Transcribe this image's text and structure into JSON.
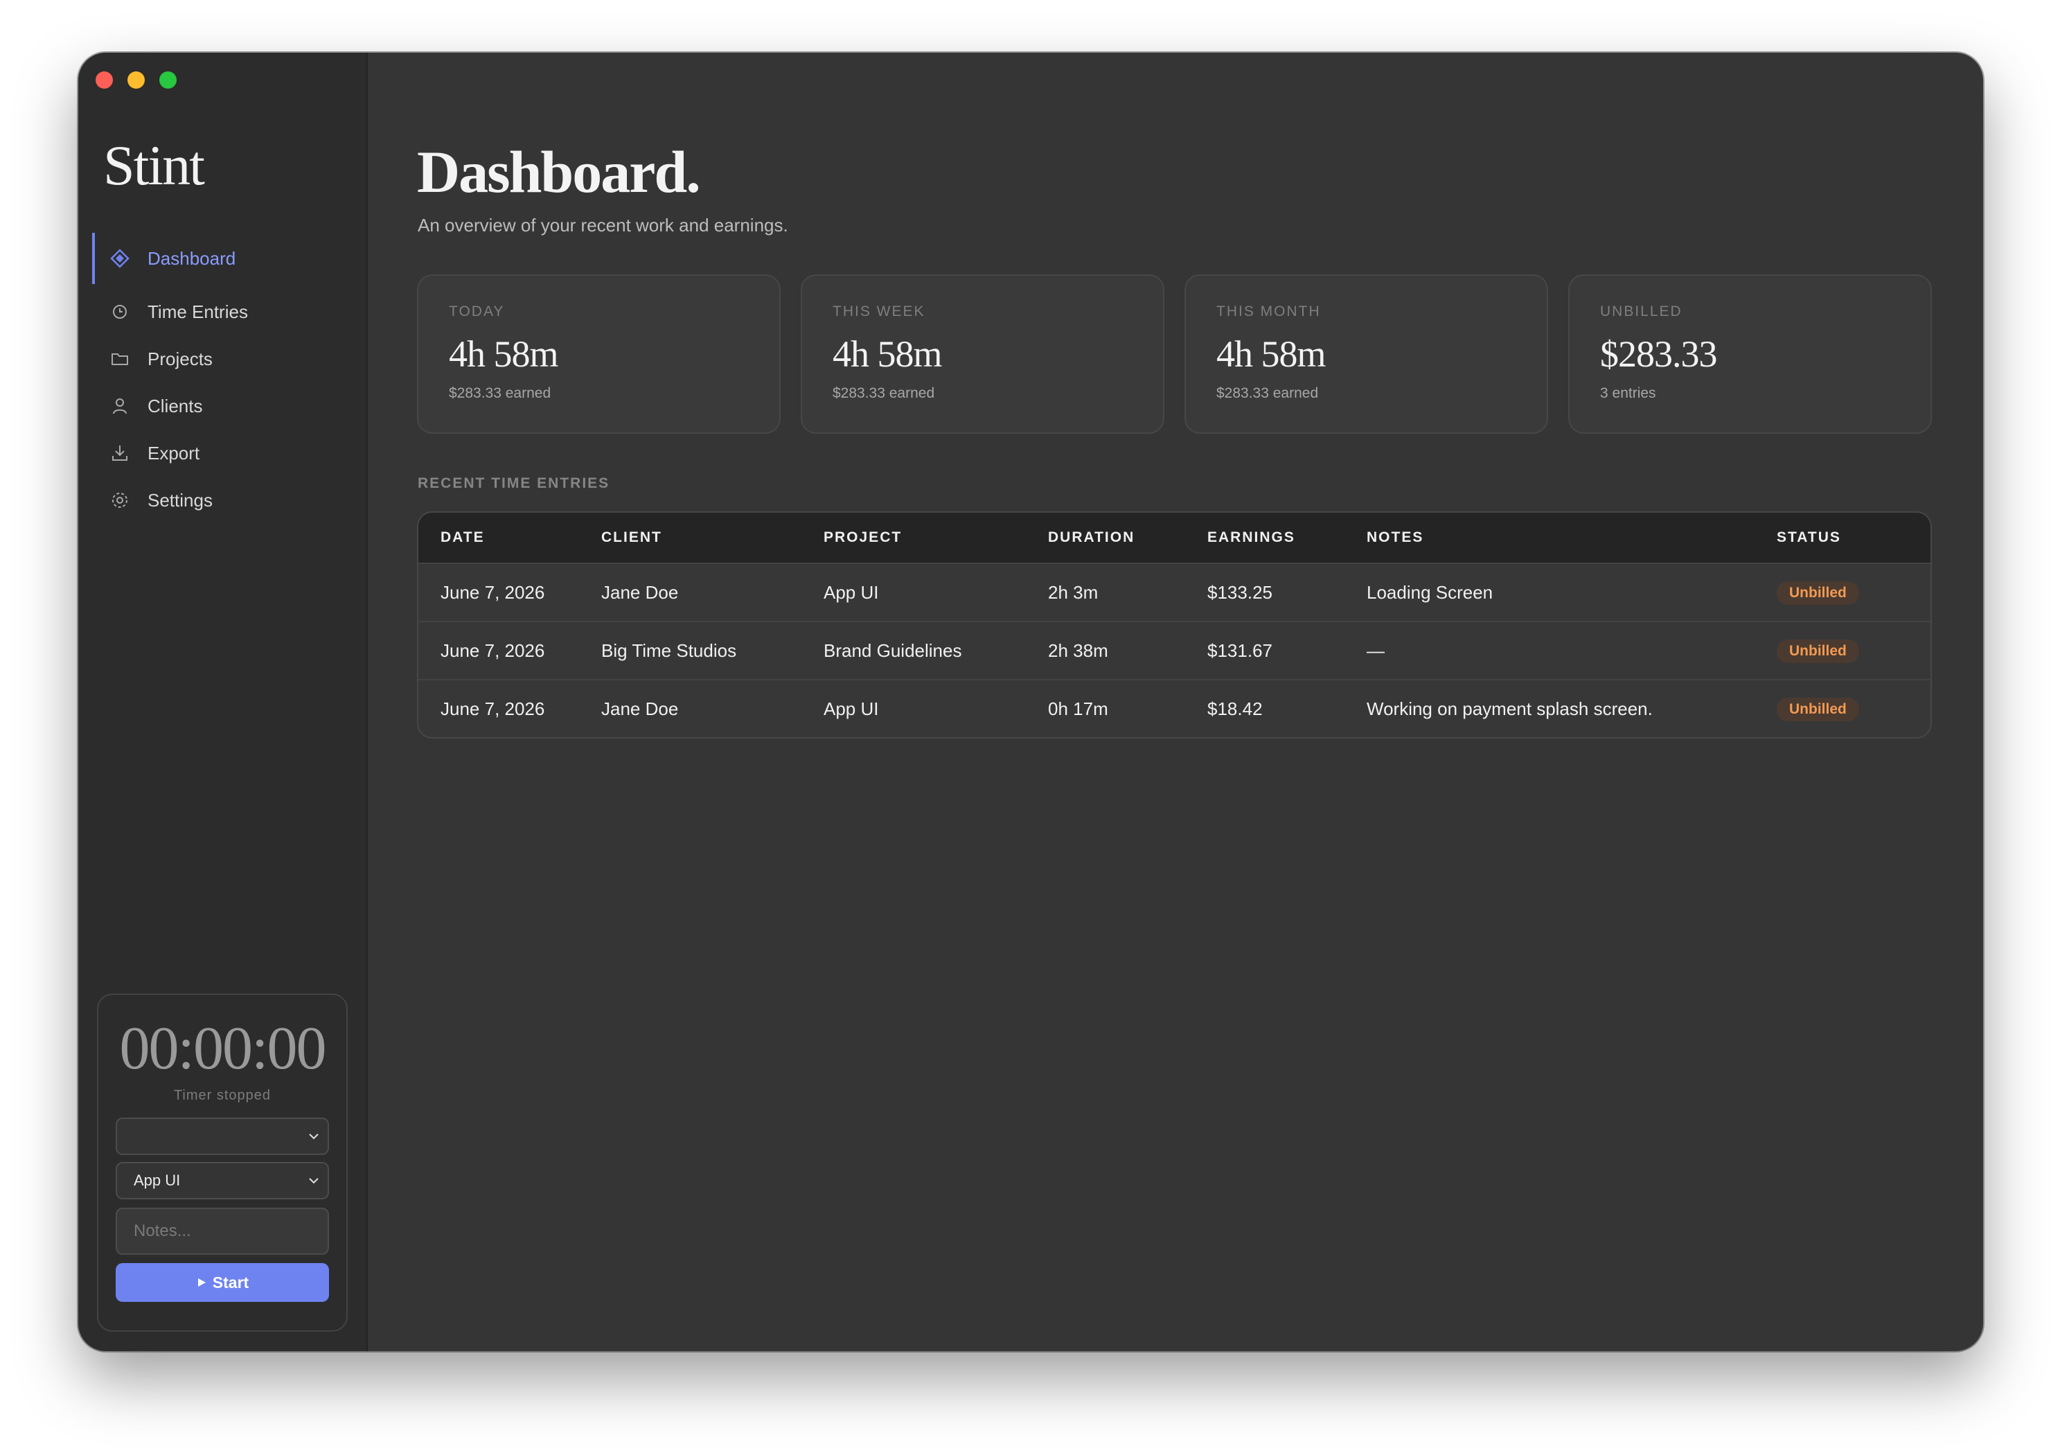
{
  "app": {
    "name": "Stint"
  },
  "sidebar": {
    "items": [
      {
        "label": "Dashboard",
        "icon": "diamond-icon",
        "active": true
      },
      {
        "label": "Time Entries",
        "icon": "clock-icon",
        "active": false
      },
      {
        "label": "Projects",
        "icon": "folder-icon",
        "active": false
      },
      {
        "label": "Clients",
        "icon": "person-icon",
        "active": false
      },
      {
        "label": "Export",
        "icon": "download-icon",
        "active": false
      },
      {
        "label": "Settings",
        "icon": "gear-icon",
        "active": false
      }
    ]
  },
  "timer": {
    "display": "00:00:00",
    "status": "Timer stopped",
    "client_value": "",
    "project_value": "App UI",
    "notes_placeholder": "Notes...",
    "start_label": "Start"
  },
  "main": {
    "title": "Dashboard.",
    "subtitle": "An overview of your recent work and earnings.",
    "cards": [
      {
        "label": "TODAY",
        "value": "4h 58m",
        "sub": "$283.33 earned"
      },
      {
        "label": "THIS WEEK",
        "value": "4h 58m",
        "sub": "$283.33 earned"
      },
      {
        "label": "THIS MONTH",
        "value": "4h 58m",
        "sub": "$283.33 earned"
      },
      {
        "label": "UNBILLED",
        "value": "$283.33",
        "sub": "3 entries"
      }
    ],
    "recent_label": "RECENT TIME ENTRIES",
    "table": {
      "headers": [
        "DATE",
        "CLIENT",
        "PROJECT",
        "DURATION",
        "EARNINGS",
        "NOTES",
        "STATUS"
      ],
      "rows": [
        {
          "date": "June 7, 2026",
          "client": "Jane Doe",
          "project": "App UI",
          "duration": "2h 3m",
          "earnings": "$133.25",
          "notes": "Loading Screen",
          "status": "Unbilled"
        },
        {
          "date": "June 7, 2026",
          "client": "Big Time Studios",
          "project": "Brand Guidelines",
          "duration": "2h 38m",
          "earnings": "$131.67",
          "notes": "—",
          "status": "Unbilled"
        },
        {
          "date": "June 7, 2026",
          "client": "Jane Doe",
          "project": "App UI",
          "duration": "0h 17m",
          "earnings": "$18.42",
          "notes": "Working on payment splash screen.",
          "status": "Unbilled"
        }
      ]
    }
  },
  "colors": {
    "accent": "#6e83ef",
    "window_bg": "#353535",
    "sidebar_bg": "#2c2c2c",
    "badge_text": "#f29a52",
    "badge_bg": "#4a3a30"
  }
}
